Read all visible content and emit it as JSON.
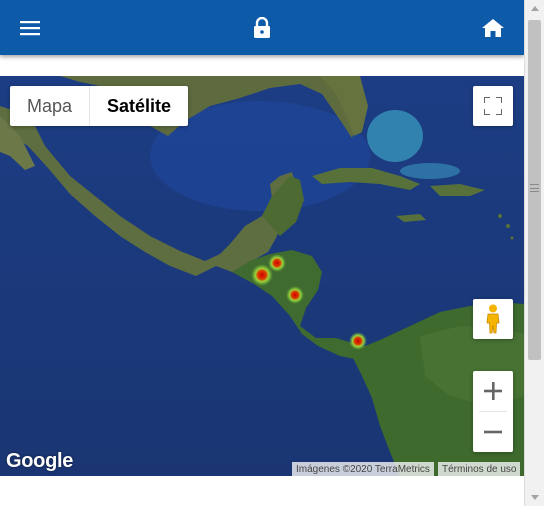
{
  "header": {
    "menu_icon": "hamburger-menu-icon",
    "lock_icon": "lock-icon",
    "home_icon": "home-icon",
    "background_color": "#0d5aa8"
  },
  "map": {
    "type_toggle": {
      "map_label": "Mapa",
      "satellite_label": "Satélite",
      "selected": "Satélite"
    },
    "controls": {
      "fullscreen_icon": "fullscreen-icon",
      "pegman_icon": "pegman-icon",
      "zoom_in_label": "+",
      "zoom_out_label": "−"
    },
    "logo_text": "Google",
    "imagery_credit": "Imágenes ©2020 TerraMetrics",
    "terms_link": "Términos de uso",
    "heatmap_points": 4
  }
}
